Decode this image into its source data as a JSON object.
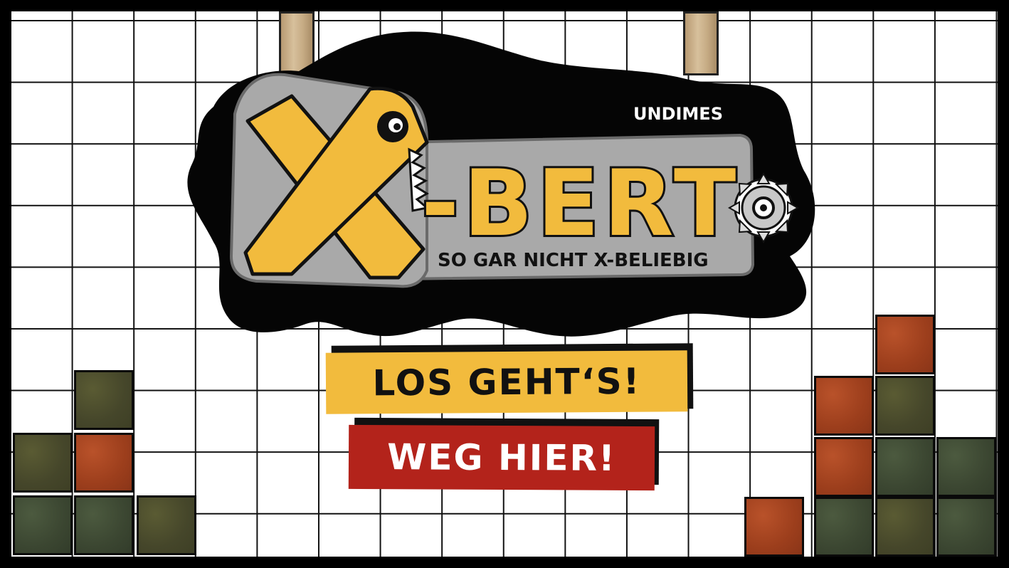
{
  "logo": {
    "publisher": "UNDIMES",
    "title_x": "X",
    "title_rest": "-BERT",
    "subtitle": "SO GAR NICHT X-BELIEBIG"
  },
  "menu": {
    "start_label": "LOS GEHT‘S!",
    "quit_label": "WEG HIER!"
  },
  "colors": {
    "yellow": "#f2bb3d",
    "red": "#b3231b",
    "olive": "#4e4f2b",
    "green": "#3f4b34",
    "rust": "#a8441f"
  }
}
